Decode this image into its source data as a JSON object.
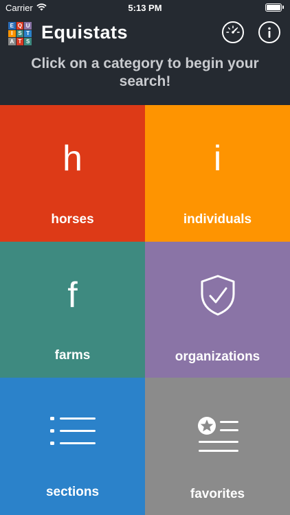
{
  "status_bar": {
    "carrier": "Carrier",
    "time": "5:13 PM"
  },
  "header": {
    "logo_letters": [
      "E",
      "Q",
      "U",
      "I",
      "S",
      "T",
      "A",
      "T",
      "S"
    ],
    "title": "Equistats",
    "instruction": "Click on a category to begin your search!",
    "icons": {
      "dashboard": "speedometer-icon",
      "info": "info-icon"
    }
  },
  "colors": {
    "horses": "#dd3a17",
    "individuals": "#fe9401",
    "farms": "#3e8a80",
    "organizations": "#8a74a6",
    "sections": "#2b82ca",
    "favorites": "#8b8b8b",
    "header_bg": "#252a31"
  },
  "categories": {
    "horses": {
      "letter": "h",
      "label": "horses"
    },
    "individuals": {
      "letter": "i",
      "label": "individuals"
    },
    "farms": {
      "letter": "f",
      "label": "farms"
    },
    "organizations": {
      "icon": "shield-check-icon",
      "label": "organizations"
    },
    "sections": {
      "icon": "list-icon",
      "label": "sections"
    },
    "favorites": {
      "icon": "star-list-icon",
      "label": "favorites"
    }
  }
}
